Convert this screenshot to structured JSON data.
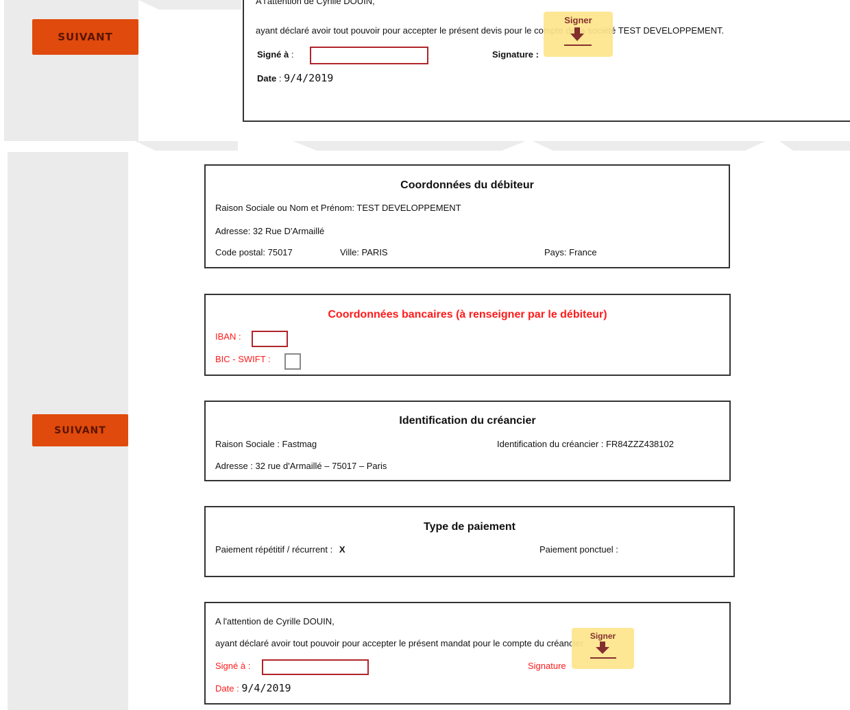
{
  "top": {
    "suivant_label": "SUIVANT",
    "attention_partial": "A l'attention de Cyrille DOUIN,",
    "declaration": "ayant déclaré avoir tout pouvoir pour accepter le présent devis pour le compte de la société TEST DEVELOPPEMENT.",
    "signe_label": "Signé à",
    "colon": ":",
    "signature_label": "Signature :",
    "date_label": "Date",
    "date_value": "9/4/2019",
    "signer_label": "Signer"
  },
  "bottom": {
    "suivant_label": "SUIVANT",
    "debiteur": {
      "title": "Coordonnées du débiteur",
      "raison": "Raison Sociale ou Nom et Prénom: TEST DEVELOPPEMENT",
      "adresse": "Adresse: 32 Rue D'Armaillé",
      "code_postal": "Code postal: 75017",
      "ville": "Ville: PARIS",
      "pays": "Pays: France"
    },
    "bancaires": {
      "title": "Coordonnées bancaires (à renseigner par le débiteur)",
      "iban_label": "IBAN :",
      "bic_label": "BIC - SWIFT :"
    },
    "creancier": {
      "title": "Identification du créancier",
      "raison": "Raison Sociale : Fastmag",
      "identification": "Identification du créancier : FR84ZZZ438102",
      "adresse": "Adresse : 32 rue d'Armaillé – 75017 – Paris"
    },
    "paiement": {
      "title": "Type de paiement",
      "repetitif_label": "Paiement répétitif / récurrent :",
      "repetitif_value": "X",
      "ponctuel_label": "Paiement ponctuel :"
    },
    "mandat": {
      "attention": "A l'attention de Cyrille DOUIN,",
      "declaration": "ayant déclaré avoir tout pouvoir pour accepter le présent mandat pour le compte du créancier.",
      "signe_label": "Signé à :",
      "signature_label": "Signature",
      "date_label": "Date",
      "colon": ":",
      "date_value": "9/4/2019",
      "signer_label": "Signer"
    }
  },
  "colors": {
    "accent": "#e04a0c",
    "required_red": "#ff1a1a",
    "signer_bg": "#fde58b"
  }
}
